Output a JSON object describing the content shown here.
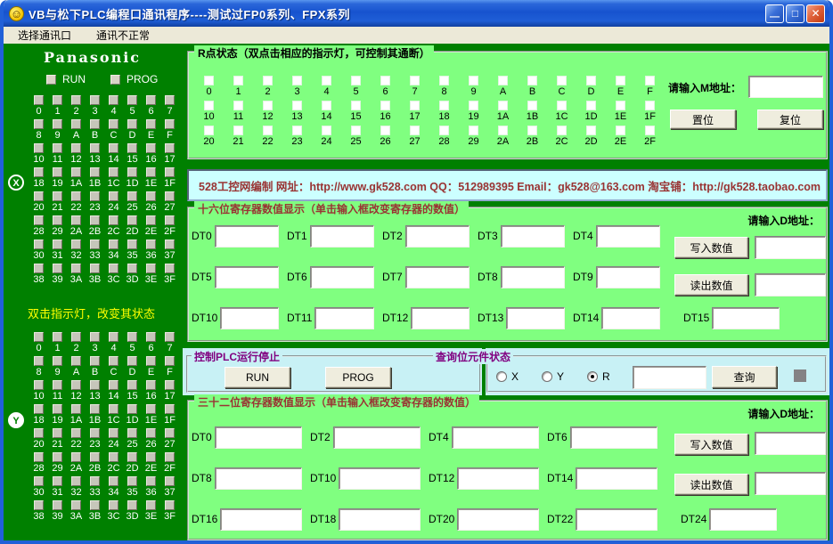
{
  "window": {
    "title": "VB与松下PLC编程口通讯程序----测试过FP0系列、FPX系列",
    "icon_glyph": "☺",
    "controls": {
      "minimize": "—",
      "maximize": "□",
      "close": "✕"
    }
  },
  "menu": {
    "items": [
      {
        "label": "选择通讯口"
      },
      {
        "label": "通讯不正常"
      }
    ]
  },
  "sidebar": {
    "brand": "Panasonic",
    "run_label": "RUN",
    "prog_label": "PROG",
    "hint": "双击指示灯，改变其状态",
    "x_badge": "X",
    "y_badge": "Y",
    "grid_rows": [
      [
        "0",
        "1",
        "2",
        "3",
        "4",
        "5",
        "6",
        "7"
      ],
      [
        "8",
        "9",
        "A",
        "B",
        "C",
        "D",
        "E",
        "F"
      ],
      [
        "10",
        "11",
        "12",
        "13",
        "14",
        "15",
        "16",
        "17"
      ],
      [
        "18",
        "19",
        "1A",
        "1B",
        "1C",
        "1D",
        "1E",
        "1F"
      ],
      [
        "20",
        "21",
        "22",
        "23",
        "24",
        "25",
        "26",
        "27"
      ],
      [
        "28",
        "29",
        "2A",
        "2B",
        "2C",
        "2D",
        "2E",
        "2F"
      ],
      [
        "30",
        "31",
        "32",
        "33",
        "34",
        "35",
        "36",
        "37"
      ],
      [
        "38",
        "39",
        "3A",
        "3B",
        "3C",
        "3D",
        "3E",
        "3F"
      ]
    ]
  },
  "r_group": {
    "title": "R点状态（双点击相应的指示灯，可控制其通断）",
    "rows": [
      [
        "0",
        "1",
        "2",
        "3",
        "4",
        "5",
        "6",
        "7",
        "8",
        "9",
        "A",
        "B",
        "C",
        "D",
        "E",
        "F"
      ],
      [
        "10",
        "11",
        "12",
        "13",
        "14",
        "15",
        "16",
        "17",
        "18",
        "19",
        "1A",
        "1B",
        "1C",
        "1D",
        "1E",
        "1F"
      ],
      [
        "20",
        "21",
        "22",
        "23",
        "24",
        "25",
        "26",
        "27",
        "28",
        "29",
        "2A",
        "2B",
        "2C",
        "2D",
        "2E",
        "2F"
      ]
    ],
    "m_address_label": "请输入M地址：",
    "m_address_value": "",
    "set_button": "置位",
    "reset_button": "复位"
  },
  "banner": {
    "text": "528工控网编制 网址：http://www.gk528.com QQ：512989395 Email：gk528@163.com 淘宝铺：http://gk528.taobao.com"
  },
  "reg16": {
    "title": "十六位寄存器数值显示（单击输入框改变寄存器的数值）",
    "d_address_label": "请输入D地址：",
    "write_button": "写入数值",
    "read_button": "读出数值",
    "write_value": "",
    "read_value": "",
    "rows": [
      [
        "DT0",
        "DT1",
        "DT2",
        "DT3",
        "DT4"
      ],
      [
        "DT5",
        "DT6",
        "DT7",
        "DT8",
        "DT9"
      ],
      [
        "DT10",
        "DT11",
        "DT12",
        "DT13",
        "DT14",
        "DT15"
      ]
    ]
  },
  "plc_control": {
    "title": "控制PLC运行停止",
    "run_button": "RUN",
    "prog_button": "PROG"
  },
  "query": {
    "title": "查询位元件状态",
    "radios": [
      {
        "label": "X",
        "checked": false
      },
      {
        "label": "Y",
        "checked": false
      },
      {
        "label": "R",
        "checked": true
      }
    ],
    "address_value": "",
    "query_button": "查询"
  },
  "reg32": {
    "title": "三十二位寄存器数值显示（单击输入框改变寄存器的数值）",
    "d_address_label": "请输入D地址：",
    "write_button": "写入数值",
    "read_button": "读出数值",
    "write_value": "",
    "read_value": "",
    "rows": [
      [
        "DT0",
        "DT2",
        "DT4",
        "DT6"
      ],
      [
        "DT8",
        "DT10",
        "DT12",
        "DT14"
      ],
      [
        "DT16",
        "DT18",
        "DT20",
        "DT22",
        "DT24"
      ]
    ]
  },
  "colors": {
    "titlebar_blue": "#2160d8",
    "sidebar_green": "#008000",
    "panel_green": "#80FF80",
    "strip_cyan": "#C8F1F5",
    "banner_cyan": "#CCFFFF",
    "banner_text_red": "#993333",
    "group_title_red": "#993333",
    "strip_title_purple": "#800080",
    "hint_yellow": "#FFFF00",
    "button_face": "#EFEDDE"
  }
}
